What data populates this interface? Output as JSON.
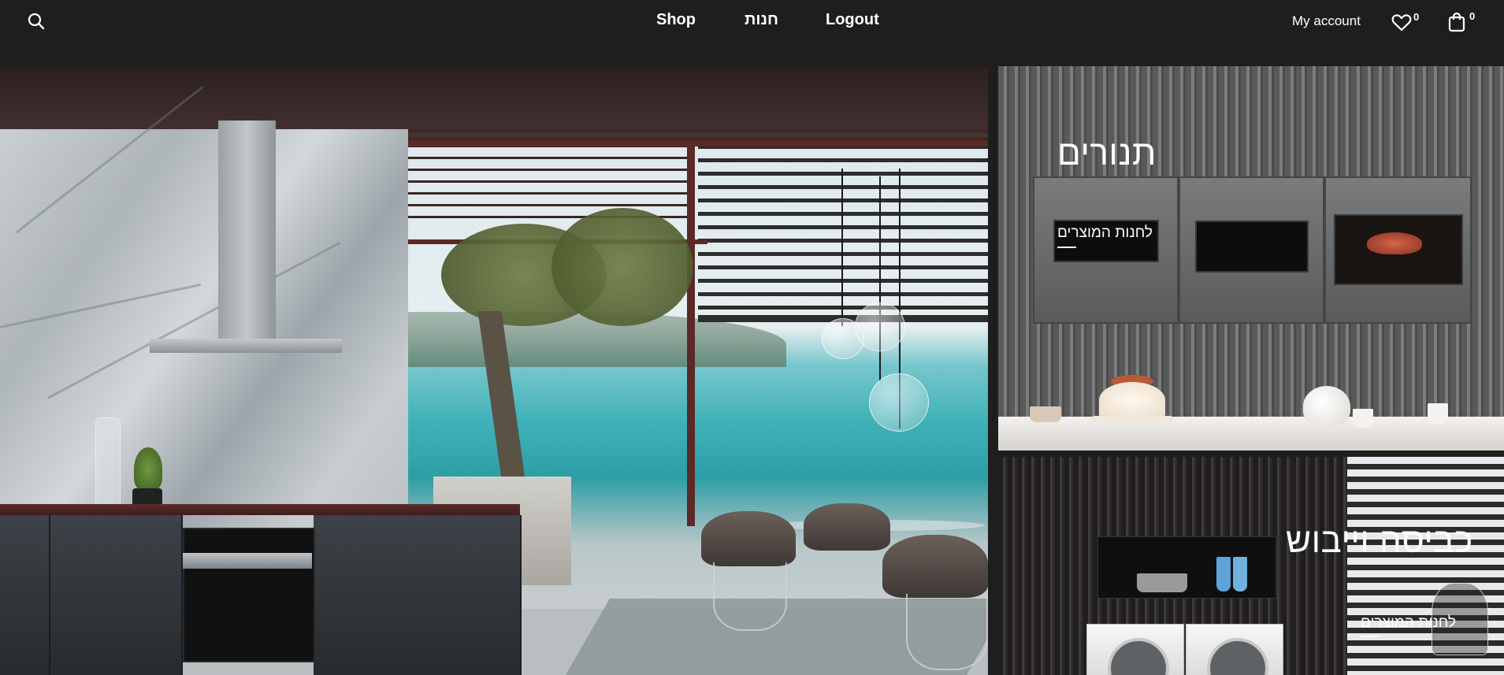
{
  "header": {
    "search_icon": "search-icon",
    "nav": [
      {
        "label": "Shop"
      },
      {
        "label": "חנות"
      },
      {
        "label": "Logout"
      }
    ],
    "account_label": "My account",
    "wishlist_count": "0",
    "cart_count": "0"
  },
  "categories": [
    {
      "title": "תנורים",
      "link": "לחנות המוצרים"
    },
    {
      "title": "כביסה וייבוש",
      "link": "לחנות המוצרים"
    }
  ],
  "colors": {
    "header_bg": "#1e1e1e",
    "text": "#ffffff"
  }
}
